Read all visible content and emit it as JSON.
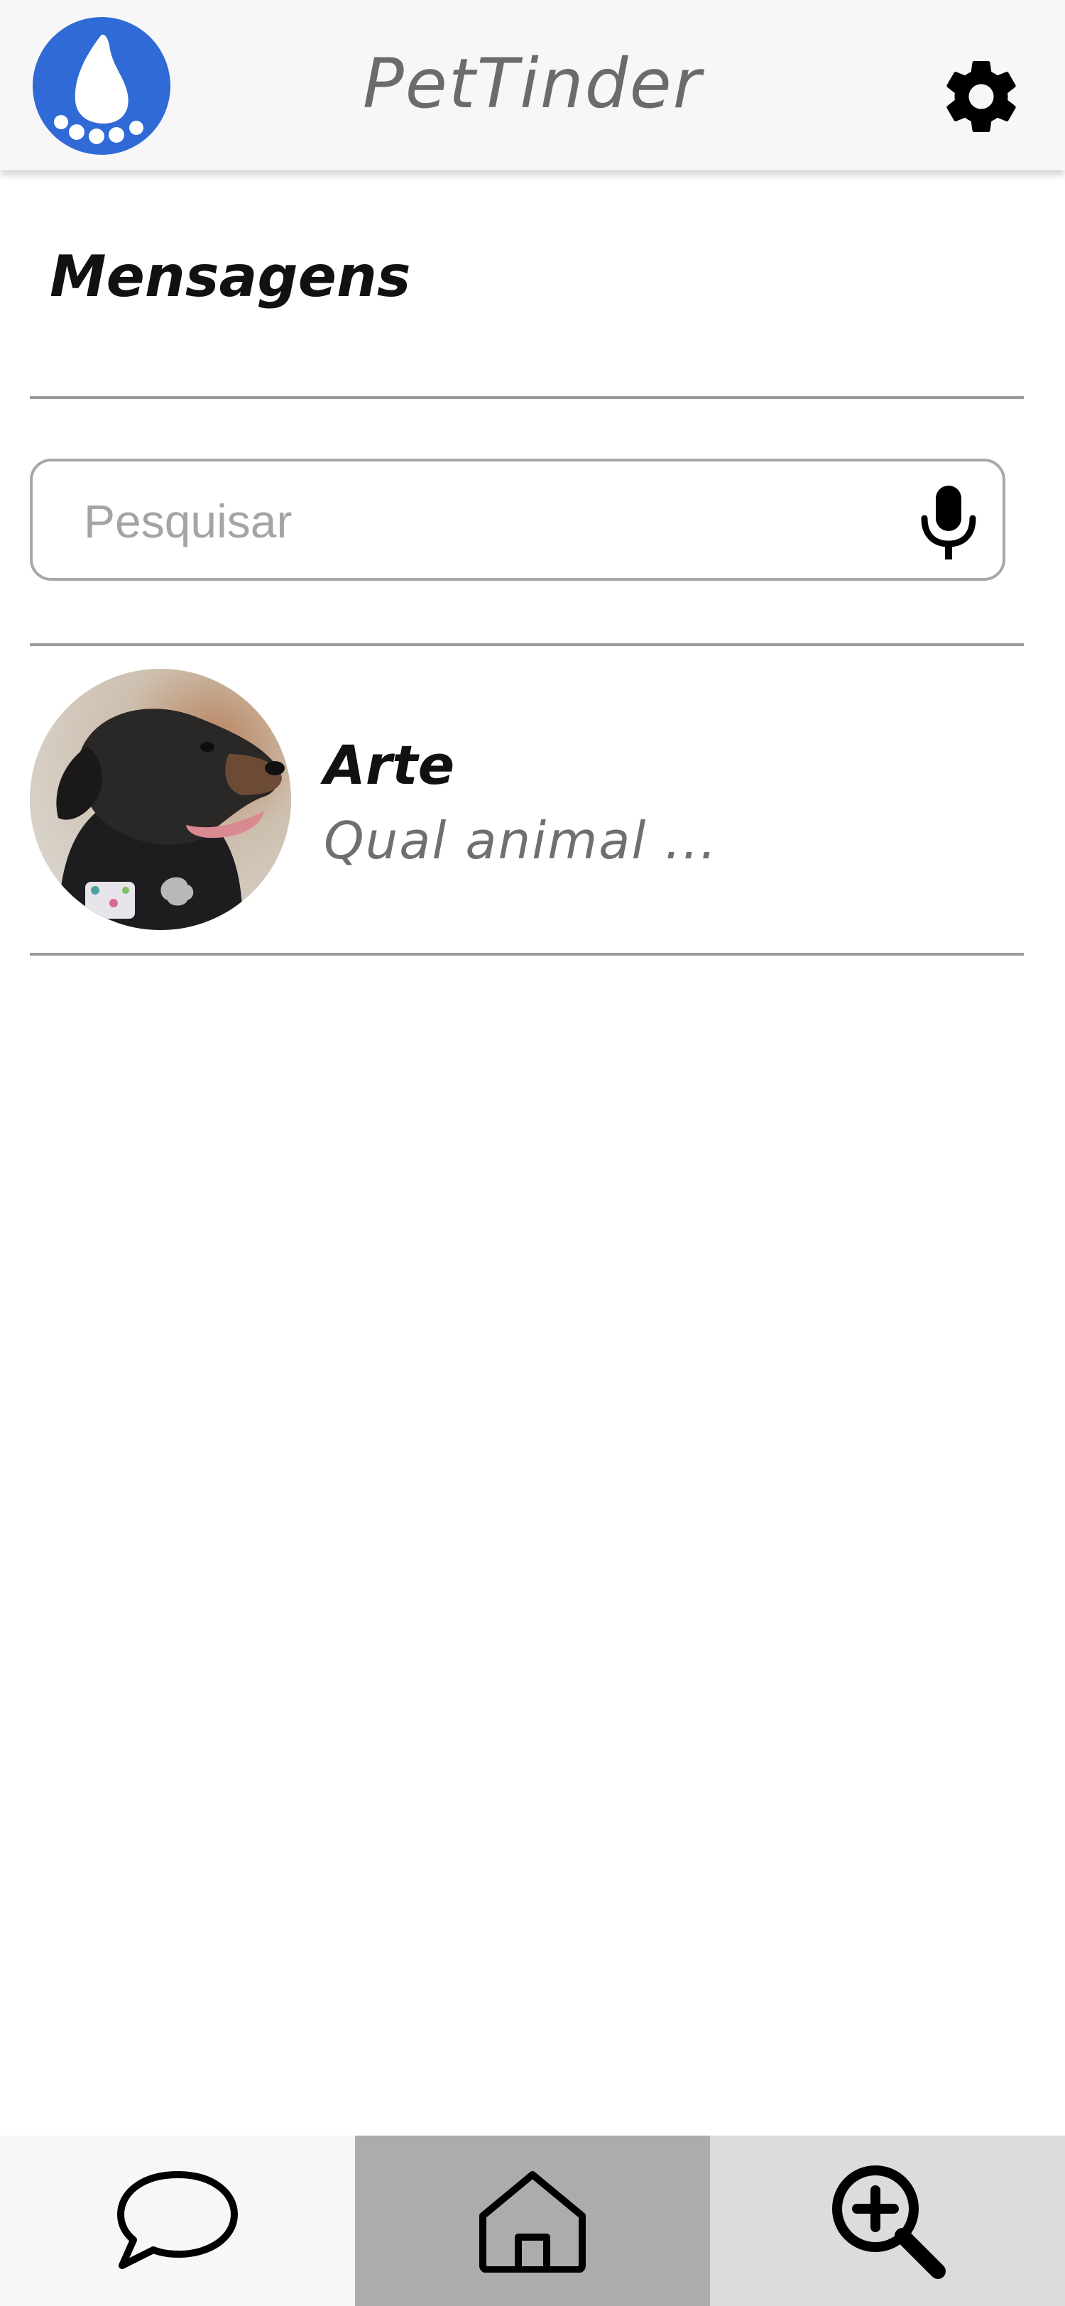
{
  "header": {
    "app_title": "PetTinder",
    "logo_icon": "paw-logo-icon",
    "settings_icon": "gear-icon"
  },
  "page": {
    "title": "Mensagens"
  },
  "search": {
    "placeholder": "Pesquisar",
    "value": "",
    "mic_icon": "microphone-icon"
  },
  "conversations": [
    {
      "name": "Arte",
      "preview": "Qual animal ...",
      "avatar": "dog-avatar"
    }
  ],
  "bottom_nav": {
    "items": [
      {
        "icon": "chat-bubble-icon",
        "active": false
      },
      {
        "icon": "home-icon",
        "active": true
      },
      {
        "icon": "zoom-in-icon",
        "active": false
      }
    ]
  },
  "colors": {
    "brand_blue": "#2f6ad6",
    "topbar_bg": "#f7f7f7",
    "nav_active_bg": "#acacac",
    "nav_search_bg": "#dcdcdc",
    "divider": "#9a9a9a"
  }
}
